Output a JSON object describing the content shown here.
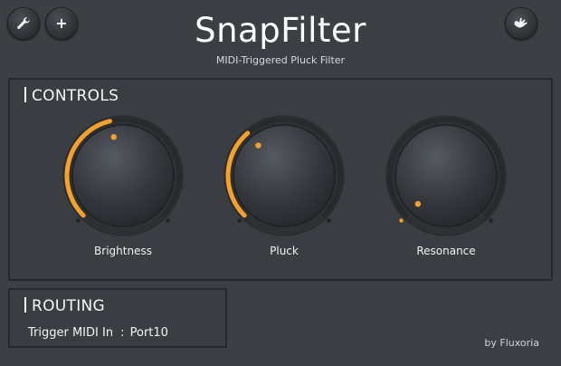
{
  "header": {
    "title": "SnapFilter",
    "subtitle": "MIDI-Triggered Pluck Filter"
  },
  "toolbar": {
    "settings_icon": "wrench-icon",
    "add_label": "+",
    "bypass_icon": "hand-icon"
  },
  "controls": {
    "heading": "CONTROLS",
    "knobs": [
      {
        "label": "Brightness",
        "value": 0.45
      },
      {
        "label": "Pluck",
        "value": 0.35
      },
      {
        "label": "Resonance",
        "value": 0.0
      }
    ]
  },
  "routing": {
    "heading": "ROUTING",
    "row_label": "Trigger MIDI In",
    "row_separator": ":",
    "row_value": "Port10"
  },
  "footer": {
    "credit": "by Fluxoria"
  },
  "colors": {
    "accent": "#f5a12a",
    "background": "#3c4045",
    "panel_border": "#25282c"
  }
}
